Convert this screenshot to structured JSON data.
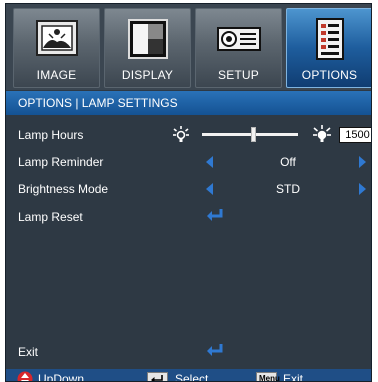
{
  "tabs": [
    {
      "label": "IMAGE",
      "icon": "image-icon",
      "active": false
    },
    {
      "label": "DISPLAY",
      "icon": "display-icon",
      "active": false
    },
    {
      "label": "SETUP",
      "icon": "projector-icon",
      "active": false
    },
    {
      "label": "OPTIONS",
      "icon": "options-icon",
      "active": true
    }
  ],
  "header": {
    "title": "OPTIONS | LAMP SETTINGS"
  },
  "rows": {
    "lamp_hours": {
      "label": "Lamp Hours",
      "value": "1500",
      "slider_fraction": 0.53
    },
    "lamp_reminder": {
      "label": "Lamp Reminder",
      "value": "Off"
    },
    "brightness_mode": {
      "label": "Brightness Mode",
      "value": "STD"
    },
    "lamp_reset": {
      "label": "Lamp Reset"
    },
    "exit": {
      "label": "Exit"
    }
  },
  "footer": {
    "updown": "UpDown",
    "select": "Select",
    "exit": "Exit",
    "menu_key": "Menu"
  },
  "colors": {
    "accent": "#2f79d2",
    "header": "#1c60a6",
    "panel": "#2e3944"
  }
}
